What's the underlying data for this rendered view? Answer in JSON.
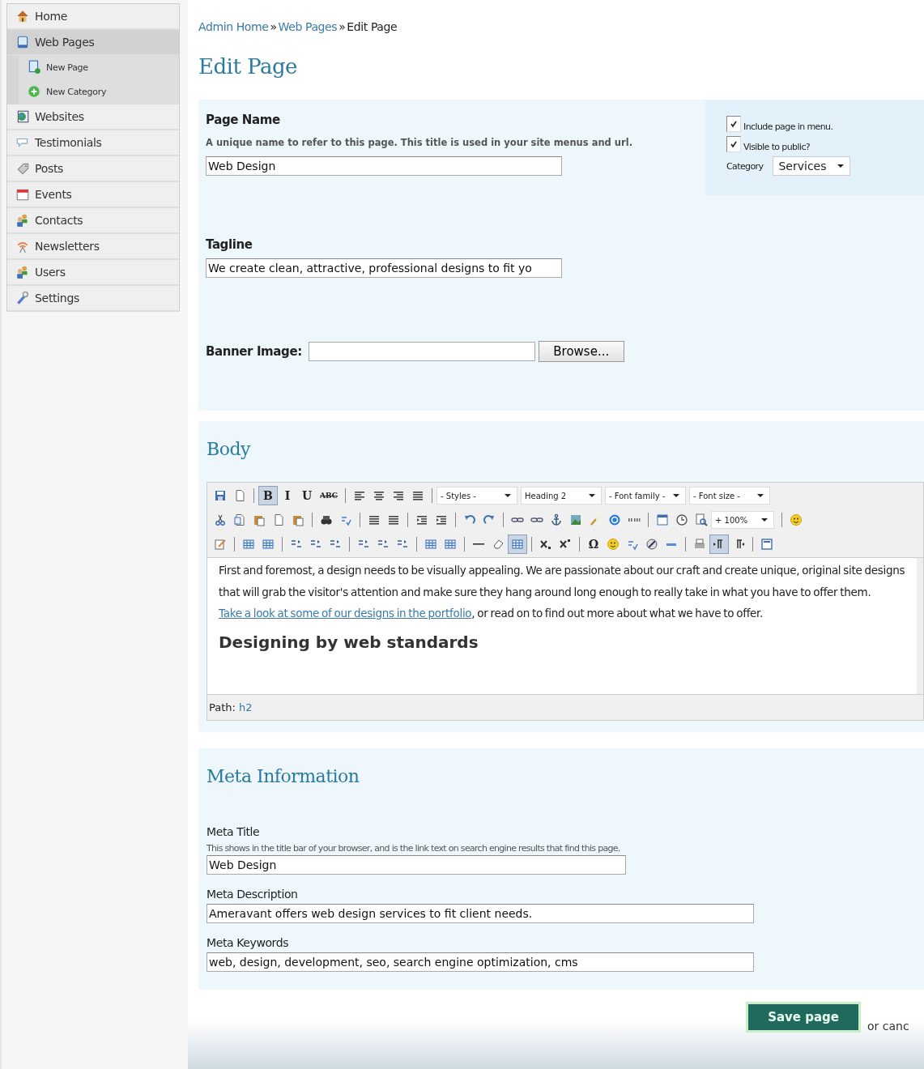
{
  "sidebar": {
    "items": [
      {
        "label": "Home",
        "selected": false
      },
      {
        "label": "Web Pages",
        "selected": true,
        "expanded": true,
        "children": [
          {
            "label": "New Page",
            "selected": false
          },
          {
            "label": "New Category",
            "selected": false
          }
        ]
      },
      {
        "label": "Websites",
        "selected": false
      },
      {
        "label": "Testimonials",
        "selected": false
      },
      {
        "label": "Posts",
        "selected": false
      },
      {
        "label": "Events",
        "selected": false
      },
      {
        "label": "Contacts",
        "selected": false
      },
      {
        "label": "Newsletters",
        "selected": false
      },
      {
        "label": "Users",
        "selected": false
      },
      {
        "label": "Settings",
        "selected": false
      }
    ]
  },
  "breadcrumb": [
    {
      "label": "Admin Home",
      "kind": "link"
    },
    {
      "label": "Web Pages",
      "kind": "link"
    },
    {
      "label": "Edit Page",
      "kind": "current"
    }
  ],
  "breadcrumb_separator": "»",
  "title": "Edit Page",
  "page_name": {
    "label": "Page Name",
    "help": "A unique name to refer to this page. This title is used in your site menus and url.",
    "value": "Web Design"
  },
  "options": {
    "include_in_menu": {
      "label": "Include page in menu.",
      "checked": true
    },
    "visible": {
      "label": "Visible to public?",
      "checked": true
    },
    "category": {
      "label": "Category",
      "value": "Services"
    }
  },
  "tagline": {
    "label": "Tagline",
    "value": "We create clean, attractive, professional designs to fit yo"
  },
  "banner": {
    "label": "Banner Image:",
    "button": "Browse..."
  },
  "body": {
    "title": "Body",
    "toolbar": [
      {
        "items": [
          {
            "kind": "icon",
            "selected": false
          },
          {
            "kind": "icon",
            "selected": false
          },
          {
            "kind": "sep"
          },
          {
            "kind": "text",
            "label": "B",
            "selected": true
          },
          {
            "kind": "text",
            "label": "I",
            "selected": false
          },
          {
            "kind": "text",
            "label": "U",
            "selected": false
          },
          {
            "kind": "text",
            "label": "ABC",
            "selected": false
          },
          {
            "kind": "sep"
          },
          {
            "kind": "icon",
            "selected": false
          },
          {
            "kind": "icon",
            "selected": false
          },
          {
            "kind": "icon",
            "selected": false
          },
          {
            "kind": "icon",
            "selected": false
          },
          {
            "kind": "sep"
          },
          {
            "kind": "select",
            "label": "- Styles -"
          },
          {
            "kind": "select",
            "label": "Heading 2"
          },
          {
            "kind": "select",
            "label": "- Font family -"
          },
          {
            "kind": "select",
            "label": "- Font size -"
          }
        ]
      },
      {
        "items": [
          {
            "kind": "icon",
            "selected": false
          },
          {
            "kind": "icon",
            "selected": false
          },
          {
            "kind": "icon",
            "selected": false
          },
          {
            "kind": "icon",
            "selected": false
          },
          {
            "kind": "icon",
            "selected": false
          },
          {
            "kind": "sep"
          },
          {
            "kind": "icon",
            "selected": false
          },
          {
            "kind": "icon",
            "selected": false
          },
          {
            "kind": "sep"
          },
          {
            "kind": "icon",
            "selected": false
          },
          {
            "kind": "icon",
            "selected": false
          },
          {
            "kind": "sep"
          },
          {
            "kind": "icon",
            "selected": false
          },
          {
            "kind": "icon",
            "selected": false
          },
          {
            "kind": "sep"
          },
          {
            "kind": "icon",
            "selected": false
          },
          {
            "kind": "icon",
            "selected": false
          },
          {
            "kind": "sep"
          },
          {
            "kind": "icon",
            "selected": false
          },
          {
            "kind": "icon",
            "selected": false
          },
          {
            "kind": "icon",
            "selected": false
          },
          {
            "kind": "icon",
            "selected": false
          },
          {
            "kind": "icon",
            "selected": false
          },
          {
            "kind": "icon",
            "selected": false
          },
          {
            "kind": "icon",
            "selected": false
          },
          {
            "kind": "sep"
          },
          {
            "kind": "icon",
            "selected": false
          },
          {
            "kind": "icon",
            "selected": false
          },
          {
            "kind": "icon",
            "selected": false
          },
          {
            "kind": "select",
            "label": "+ 100%"
          },
          {
            "kind": "sep"
          },
          {
            "kind": "icon",
            "selected": false
          }
        ]
      },
      {
        "items": [
          {
            "kind": "icon",
            "selected": false
          },
          {
            "kind": "sep"
          },
          {
            "kind": "icon",
            "selected": false
          },
          {
            "kind": "icon",
            "selected": false
          },
          {
            "kind": "sep"
          },
          {
            "kind": "icon",
            "selected": false
          },
          {
            "kind": "icon",
            "selected": false
          },
          {
            "kind": "icon",
            "selected": false
          },
          {
            "kind": "sep"
          },
          {
            "kind": "icon",
            "selected": false
          },
          {
            "kind": "icon",
            "selected": false
          },
          {
            "kind": "icon",
            "selected": false
          },
          {
            "kind": "sep"
          },
          {
            "kind": "icon",
            "selected": false
          },
          {
            "kind": "icon",
            "selected": false
          },
          {
            "kind": "sep"
          },
          {
            "kind": "icon",
            "selected": false
          },
          {
            "kind": "icon",
            "selected": false
          },
          {
            "kind": "icon",
            "selected": true
          },
          {
            "kind": "sep"
          },
          {
            "kind": "icon",
            "selected": false
          },
          {
            "kind": "icon",
            "selected": false
          },
          {
            "kind": "sep"
          },
          {
            "kind": "text",
            "label": "Ω",
            "selected": false
          },
          {
            "kind": "icon",
            "selected": false
          },
          {
            "kind": "icon",
            "selected": false
          },
          {
            "kind": "icon",
            "selected": false
          },
          {
            "kind": "icon",
            "selected": false
          },
          {
            "kind": "sep"
          },
          {
            "kind": "icon",
            "selected": false
          },
          {
            "kind": "icon",
            "selected": true
          },
          {
            "kind": "icon",
            "selected": false
          },
          {
            "kind": "sep"
          },
          {
            "kind": "icon",
            "selected": false
          }
        ]
      }
    ],
    "paragraph_before": "First and foremost, a design needs to be visually appealing.  We are passionate about our craft and create unique, original site designs that will grab the visitor's attention and make sure they hang around long enough to really take in what you have to offer them. ",
    "link": "Take a look at some of our designs in the portfolio",
    "paragraph_after": ", or read on to find out more about what we have to offer.",
    "heading": "Designing by web standards",
    "path_label": "Path:",
    "path_value": "h2"
  },
  "meta": {
    "title": "Meta Information",
    "fields": [
      {
        "label": "Meta Title",
        "help": "This shows in the title bar of your browser, and is the link text on search engine results that find this page.",
        "value": "Web Design",
        "kind": "short"
      },
      {
        "label": "Meta Description",
        "value": "Ameravant offers web design services to fit client needs.",
        "kind": "long"
      },
      {
        "label": "Meta Keywords",
        "value": "web, design, development, seo, search engine optimization, cms",
        "kind": "long"
      }
    ]
  },
  "save_button": "Save page",
  "cancel_text": "or canc"
}
